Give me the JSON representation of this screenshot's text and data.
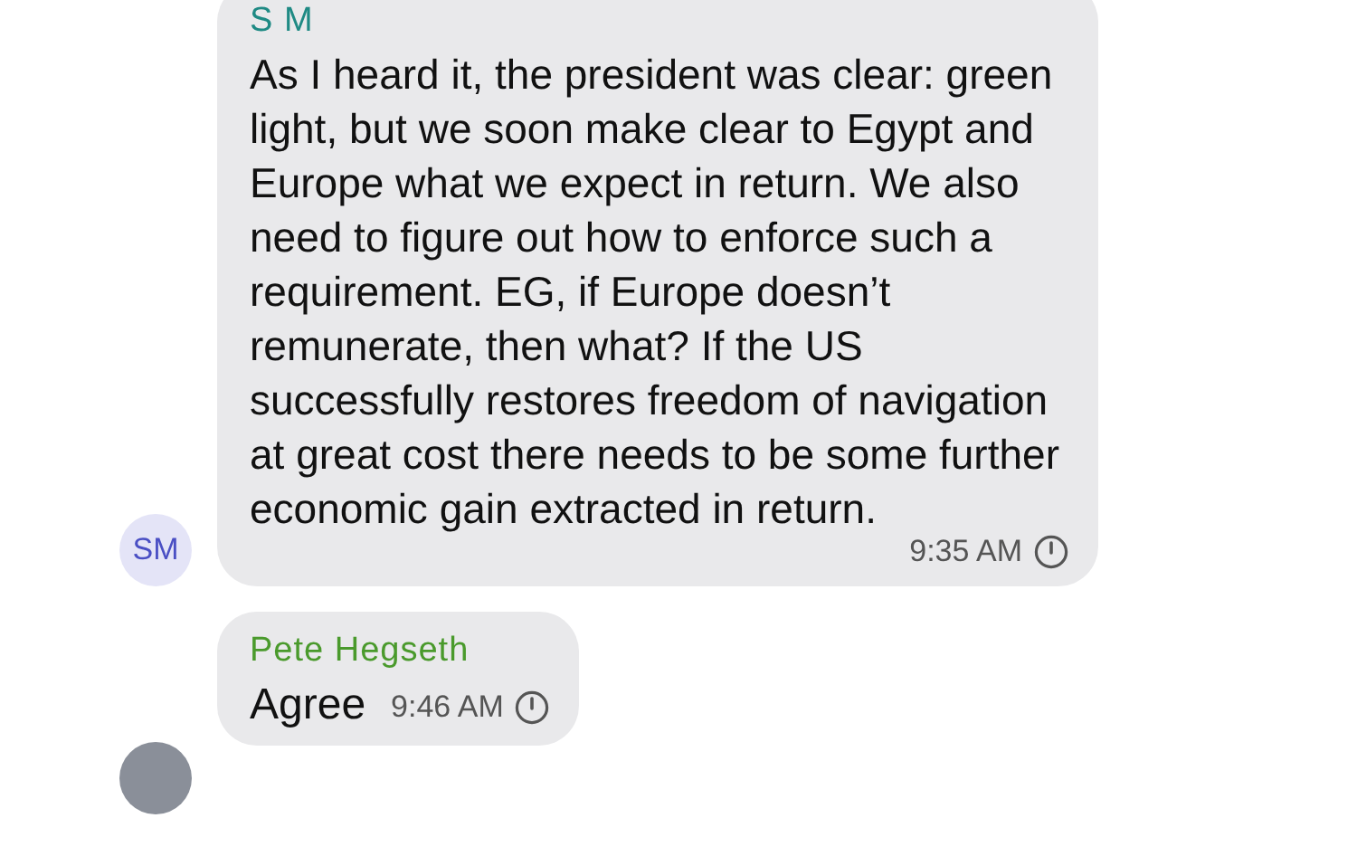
{
  "messages": [
    {
      "sender": "S M",
      "color": "#1f8a84",
      "avatar": {
        "kind": "initials",
        "initials": "SM"
      },
      "text": "As I heard it, the president was clear: green light, but we soon make clear to Egypt and Europe what we expect in return. We also need to figure out how to enforce such a requirement. EG, if Europe doesn’t remunerate, then what? If the US successfully restores freedom of navigation at great cost there needs to be some further economic gain extracted in return.",
      "time": "9:35 AM"
    },
    {
      "sender": "Pete Hegseth",
      "color": "#4a9a2c",
      "avatar": {
        "kind": "photo"
      },
      "text": "Agree",
      "time": "9:46 AM"
    }
  ]
}
